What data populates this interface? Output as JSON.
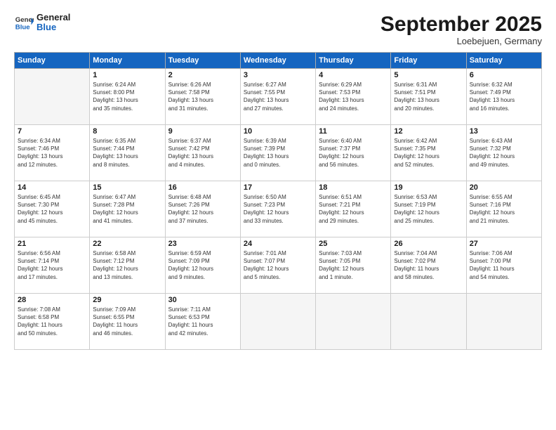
{
  "logo": {
    "line1": "General",
    "line2": "Blue"
  },
  "title": "September 2025",
  "location": "Loebejuen, Germany",
  "days_header": [
    "Sunday",
    "Monday",
    "Tuesday",
    "Wednesday",
    "Thursday",
    "Friday",
    "Saturday"
  ],
  "weeks": [
    [
      {
        "day": "",
        "info": ""
      },
      {
        "day": "1",
        "info": "Sunrise: 6:24 AM\nSunset: 8:00 PM\nDaylight: 13 hours\nand 35 minutes."
      },
      {
        "day": "2",
        "info": "Sunrise: 6:26 AM\nSunset: 7:58 PM\nDaylight: 13 hours\nand 31 minutes."
      },
      {
        "day": "3",
        "info": "Sunrise: 6:27 AM\nSunset: 7:55 PM\nDaylight: 13 hours\nand 27 minutes."
      },
      {
        "day": "4",
        "info": "Sunrise: 6:29 AM\nSunset: 7:53 PM\nDaylight: 13 hours\nand 24 minutes."
      },
      {
        "day": "5",
        "info": "Sunrise: 6:31 AM\nSunset: 7:51 PM\nDaylight: 13 hours\nand 20 minutes."
      },
      {
        "day": "6",
        "info": "Sunrise: 6:32 AM\nSunset: 7:49 PM\nDaylight: 13 hours\nand 16 minutes."
      }
    ],
    [
      {
        "day": "7",
        "info": "Sunrise: 6:34 AM\nSunset: 7:46 PM\nDaylight: 13 hours\nand 12 minutes."
      },
      {
        "day": "8",
        "info": "Sunrise: 6:35 AM\nSunset: 7:44 PM\nDaylight: 13 hours\nand 8 minutes."
      },
      {
        "day": "9",
        "info": "Sunrise: 6:37 AM\nSunset: 7:42 PM\nDaylight: 13 hours\nand 4 minutes."
      },
      {
        "day": "10",
        "info": "Sunrise: 6:39 AM\nSunset: 7:39 PM\nDaylight: 13 hours\nand 0 minutes."
      },
      {
        "day": "11",
        "info": "Sunrise: 6:40 AM\nSunset: 7:37 PM\nDaylight: 12 hours\nand 56 minutes."
      },
      {
        "day": "12",
        "info": "Sunrise: 6:42 AM\nSunset: 7:35 PM\nDaylight: 12 hours\nand 52 minutes."
      },
      {
        "day": "13",
        "info": "Sunrise: 6:43 AM\nSunset: 7:32 PM\nDaylight: 12 hours\nand 49 minutes."
      }
    ],
    [
      {
        "day": "14",
        "info": "Sunrise: 6:45 AM\nSunset: 7:30 PM\nDaylight: 12 hours\nand 45 minutes."
      },
      {
        "day": "15",
        "info": "Sunrise: 6:47 AM\nSunset: 7:28 PM\nDaylight: 12 hours\nand 41 minutes."
      },
      {
        "day": "16",
        "info": "Sunrise: 6:48 AM\nSunset: 7:26 PM\nDaylight: 12 hours\nand 37 minutes."
      },
      {
        "day": "17",
        "info": "Sunrise: 6:50 AM\nSunset: 7:23 PM\nDaylight: 12 hours\nand 33 minutes."
      },
      {
        "day": "18",
        "info": "Sunrise: 6:51 AM\nSunset: 7:21 PM\nDaylight: 12 hours\nand 29 minutes."
      },
      {
        "day": "19",
        "info": "Sunrise: 6:53 AM\nSunset: 7:19 PM\nDaylight: 12 hours\nand 25 minutes."
      },
      {
        "day": "20",
        "info": "Sunrise: 6:55 AM\nSunset: 7:16 PM\nDaylight: 12 hours\nand 21 minutes."
      }
    ],
    [
      {
        "day": "21",
        "info": "Sunrise: 6:56 AM\nSunset: 7:14 PM\nDaylight: 12 hours\nand 17 minutes."
      },
      {
        "day": "22",
        "info": "Sunrise: 6:58 AM\nSunset: 7:12 PM\nDaylight: 12 hours\nand 13 minutes."
      },
      {
        "day": "23",
        "info": "Sunrise: 6:59 AM\nSunset: 7:09 PM\nDaylight: 12 hours\nand 9 minutes."
      },
      {
        "day": "24",
        "info": "Sunrise: 7:01 AM\nSunset: 7:07 PM\nDaylight: 12 hours\nand 5 minutes."
      },
      {
        "day": "25",
        "info": "Sunrise: 7:03 AM\nSunset: 7:05 PM\nDaylight: 12 hours\nand 1 minute."
      },
      {
        "day": "26",
        "info": "Sunrise: 7:04 AM\nSunset: 7:02 PM\nDaylight: 11 hours\nand 58 minutes."
      },
      {
        "day": "27",
        "info": "Sunrise: 7:06 AM\nSunset: 7:00 PM\nDaylight: 11 hours\nand 54 minutes."
      }
    ],
    [
      {
        "day": "28",
        "info": "Sunrise: 7:08 AM\nSunset: 6:58 PM\nDaylight: 11 hours\nand 50 minutes."
      },
      {
        "day": "29",
        "info": "Sunrise: 7:09 AM\nSunset: 6:55 PM\nDaylight: 11 hours\nand 46 minutes."
      },
      {
        "day": "30",
        "info": "Sunrise: 7:11 AM\nSunset: 6:53 PM\nDaylight: 11 hours\nand 42 minutes."
      },
      {
        "day": "",
        "info": ""
      },
      {
        "day": "",
        "info": ""
      },
      {
        "day": "",
        "info": ""
      },
      {
        "day": "",
        "info": ""
      }
    ]
  ]
}
